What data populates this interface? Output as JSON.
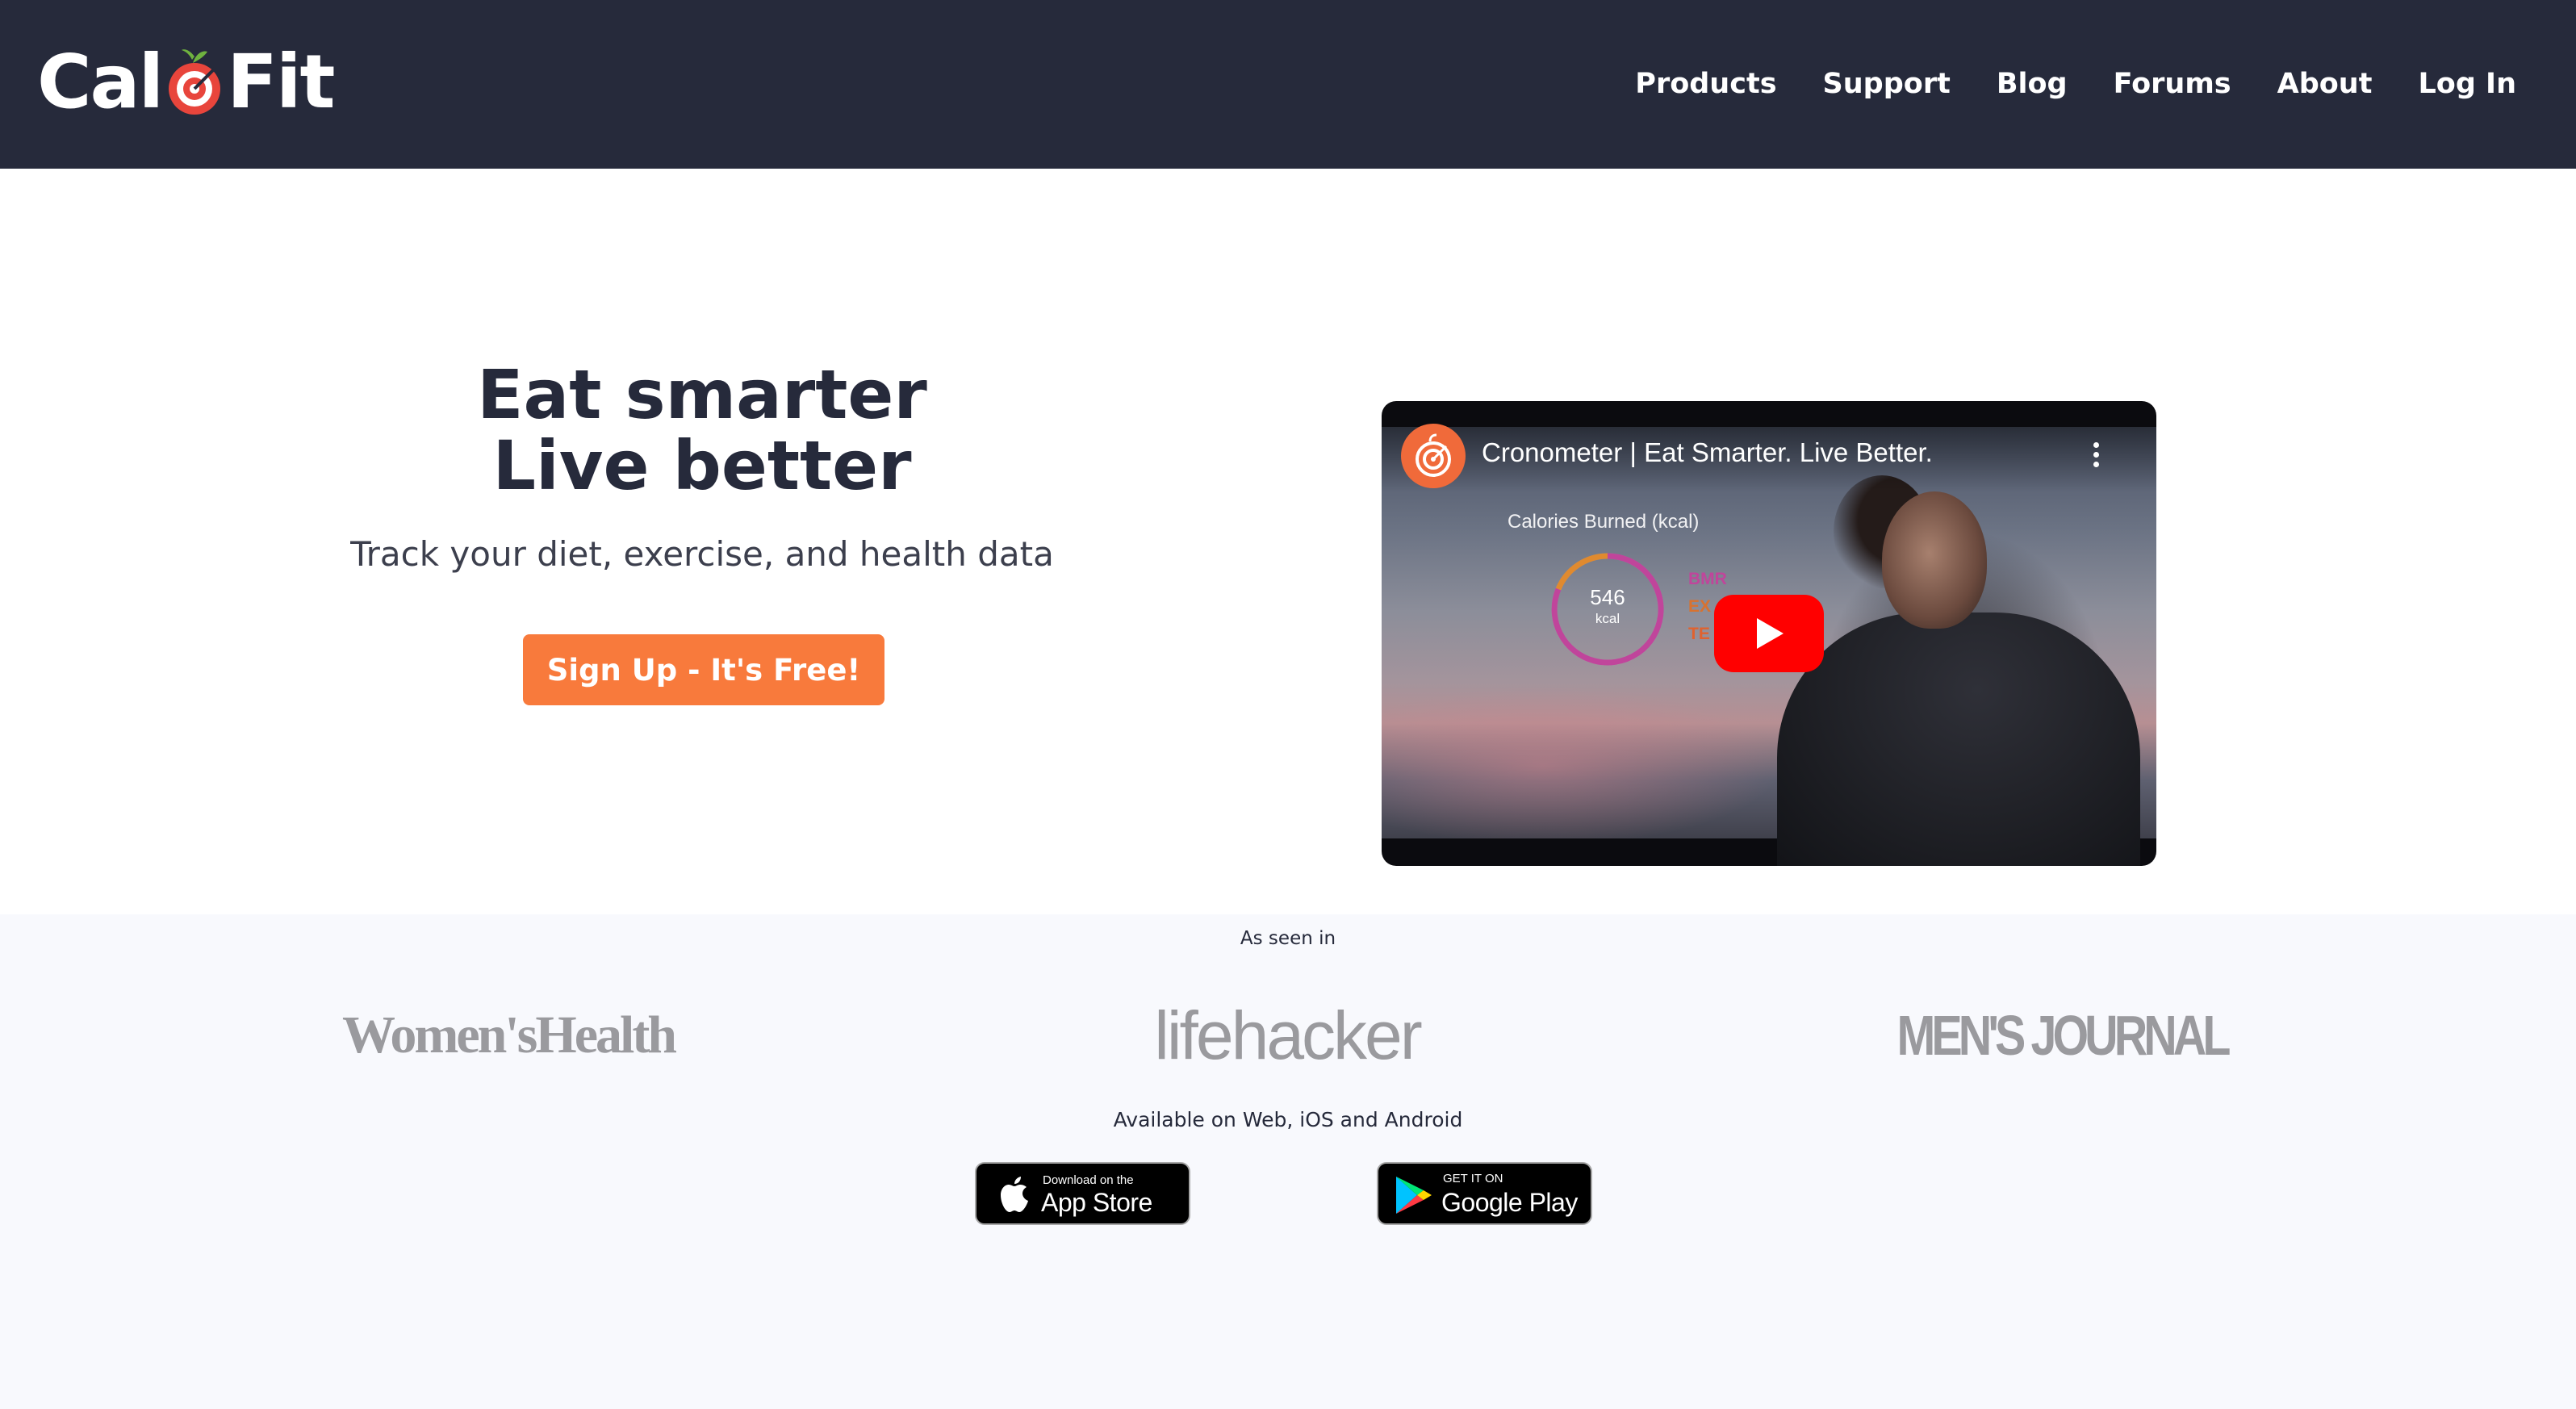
{
  "brand": {
    "name_left": "Cal",
    "name_right": "Fit",
    "logo_icon": "apple-target-icon",
    "colors": {
      "header_bg": "#262a3b",
      "accent": "#f87a3c",
      "band_bg": "#f8f9fd"
    }
  },
  "nav": {
    "items": [
      {
        "label": "Products"
      },
      {
        "label": "Support"
      },
      {
        "label": "Blog"
      },
      {
        "label": "Forums"
      },
      {
        "label": "About"
      },
      {
        "label": "Log In"
      }
    ]
  },
  "hero": {
    "title_line1": "Eat smarter",
    "title_line2": "Live better",
    "subtitle": "Track your diet, exercise, and health data",
    "cta_label": "Sign Up - It's Free!"
  },
  "video": {
    "title": "Cronometer | Eat Smarter. Live Better.",
    "overlay_caption": "Calories Burned (kcal)",
    "ring_value": "546",
    "ring_unit": "kcal",
    "legend": [
      {
        "label": "BMR",
        "color": "#c0459b"
      },
      {
        "label": "EX",
        "color": "#d8722f"
      },
      {
        "label": "TE",
        "color": "#e0622f"
      }
    ],
    "play_icon": "play-icon",
    "menu_icon": "more-vertical-icon"
  },
  "press": {
    "label": "As seen in",
    "logos": [
      {
        "text": "Women'sHealth"
      },
      {
        "text": "lifehacker"
      },
      {
        "text": "MEN'S JOURNAL"
      }
    ]
  },
  "platforms": {
    "label": "Available on Web, iOS and Android",
    "app_store": {
      "small": "Download on the",
      "big": "App Store",
      "icon": "apple-icon"
    },
    "google_play": {
      "small": "GET IT ON",
      "big": "Google Play",
      "icon": "google-play-icon"
    }
  }
}
